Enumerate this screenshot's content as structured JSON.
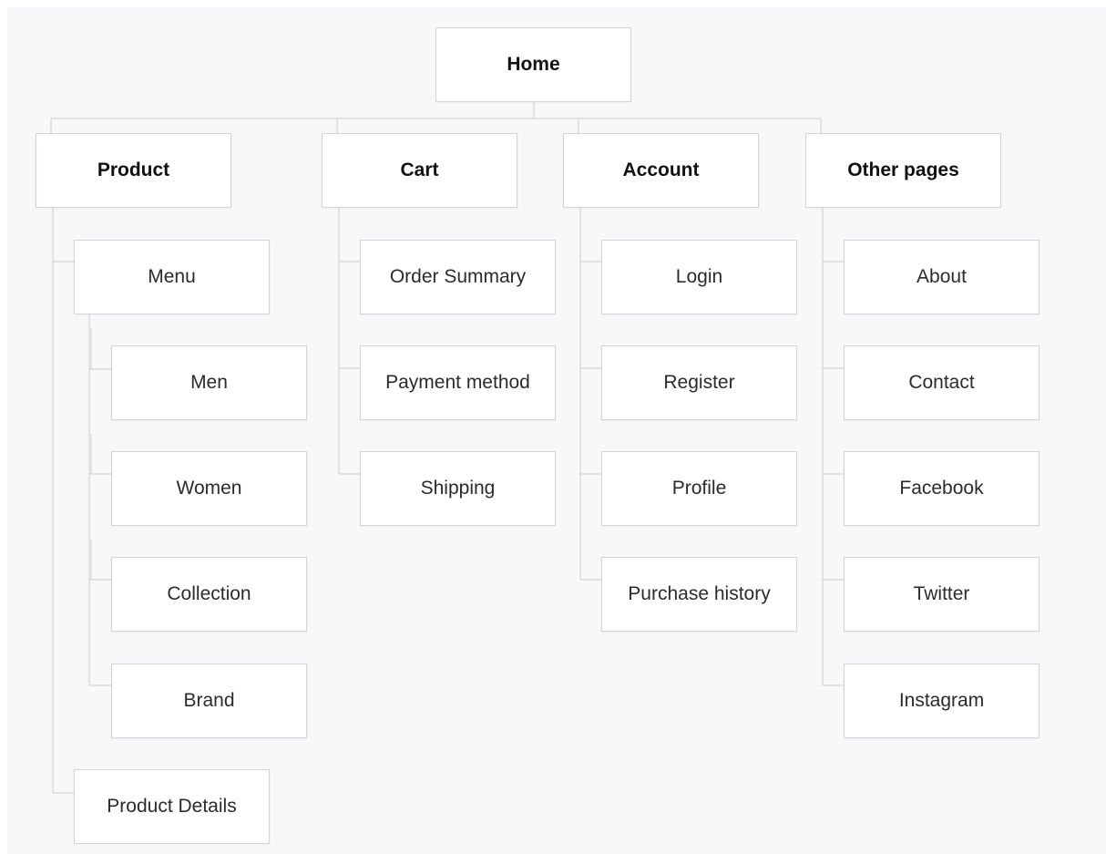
{
  "diagram": {
    "root": {
      "label": "Home"
    },
    "sections": [
      {
        "label": "Product",
        "children": [
          {
            "label": "Menu",
            "children": [
              {
                "label": "Men"
              },
              {
                "label": "Women"
              },
              {
                "label": "Collection"
              },
              {
                "label": "Brand"
              }
            ]
          },
          {
            "label": "Product Details"
          }
        ]
      },
      {
        "label": "Cart",
        "children": [
          {
            "label": "Order Summary"
          },
          {
            "label": "Payment method"
          },
          {
            "label": "Shipping"
          }
        ]
      },
      {
        "label": "Account",
        "children": [
          {
            "label": "Login"
          },
          {
            "label": "Register"
          },
          {
            "label": "Profile"
          },
          {
            "label": "Purchase history"
          }
        ]
      },
      {
        "label": "Other pages",
        "children": [
          {
            "label": "About"
          },
          {
            "label": "Contact"
          },
          {
            "label": "Facebook"
          },
          {
            "label": "Twitter"
          },
          {
            "label": "Instagram"
          }
        ]
      }
    ]
  }
}
